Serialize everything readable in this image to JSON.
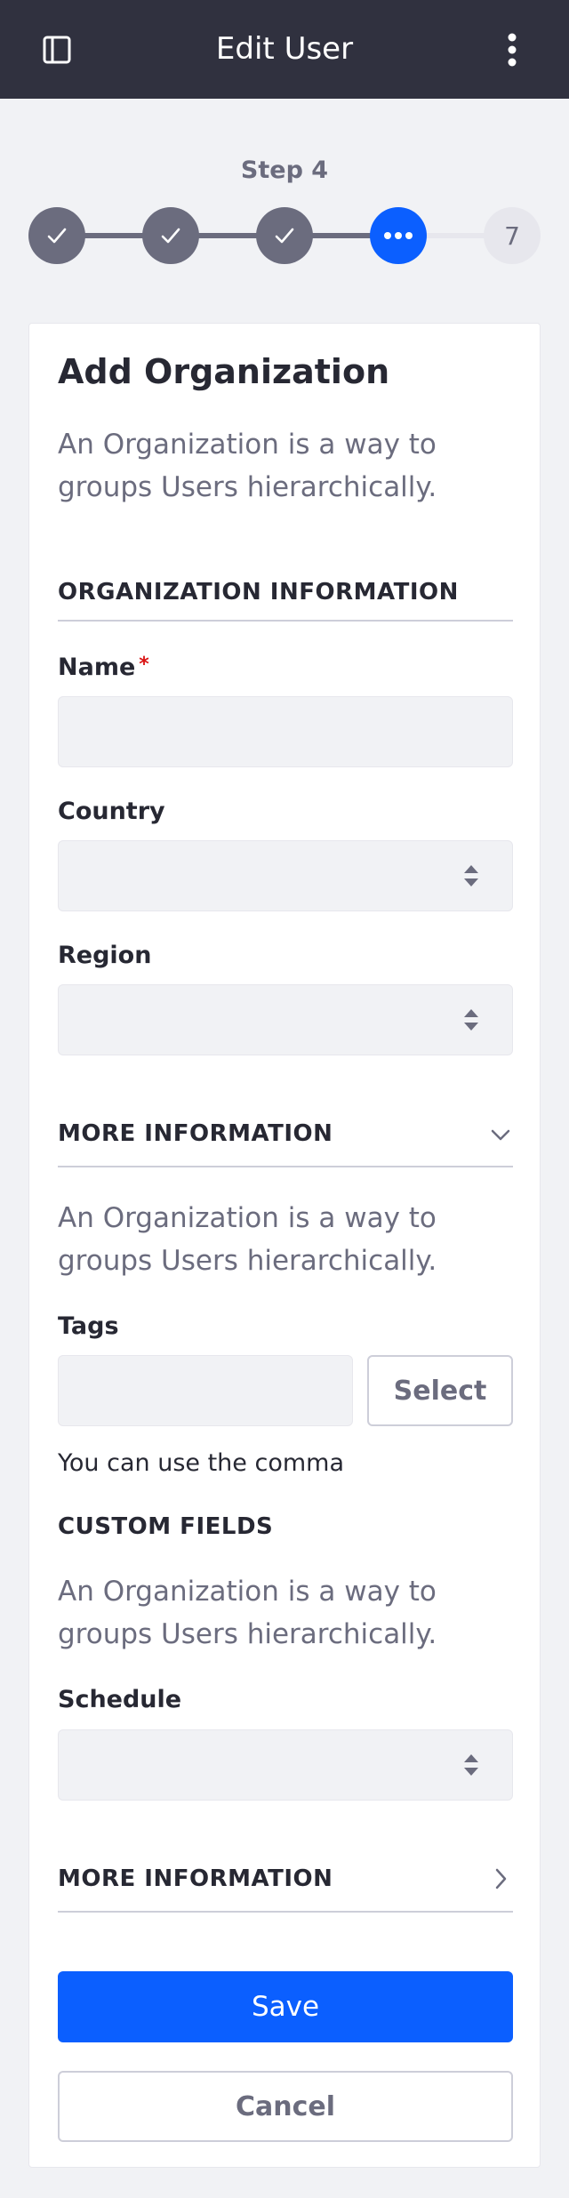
{
  "header": {
    "title": "Edit User",
    "sidebar_toggle_icon": "sidebar-toggle-icon",
    "menu_icon": "kebab-menu-icon",
    "background": "#30313f"
  },
  "stepper": {
    "label": "Step 4",
    "steps": [
      {
        "state": "complete",
        "icon": "check-icon"
      },
      {
        "state": "complete",
        "icon": "check-icon"
      },
      {
        "state": "complete",
        "icon": "check-icon"
      },
      {
        "state": "active",
        "icon": "ellipsis-icon"
      },
      {
        "state": "upcoming",
        "label": "7"
      }
    ],
    "active_color": "#0b5fff"
  },
  "form": {
    "title": "Add Organization",
    "description": "An Organization is a way to groups Users hierarchically.",
    "section1": {
      "title": "ORGANIZATION INFORMATION",
      "name_label": "Name",
      "name_required_mark": "*",
      "name_value": "",
      "country_label": "Country",
      "country_value": "",
      "region_label": "Region",
      "region_value": ""
    },
    "section2": {
      "title": "MORE INFORMATION",
      "expanded": true,
      "description": "An Organization is a way to groups Users hierarchically.",
      "tags_label": "Tags",
      "tags_value": "",
      "select_button": "Select",
      "help_text": "You can use the comma"
    },
    "section3": {
      "title": "CUSTOM FIELDS",
      "description": "An Organization is a way to groups Users hierarchically.",
      "schedule_label": "Schedule",
      "schedule_value": ""
    },
    "section4": {
      "title": "MORE INFORMATION",
      "expanded": false
    },
    "save_button": "Save",
    "cancel_button": "Cancel"
  }
}
